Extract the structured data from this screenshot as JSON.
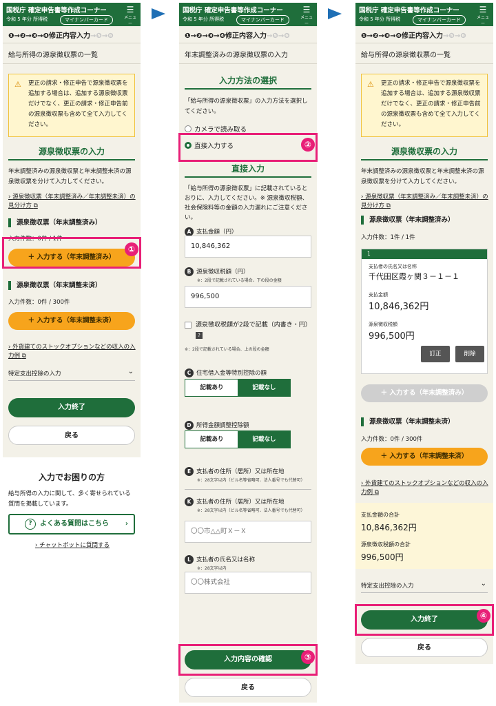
{
  "header": {
    "title": "国税庁 確定申告書等作成コーナー",
    "year": "令和 5 年分 所得税",
    "mynumber_btn": "マイナンバーカード",
    "menu_label": "メニュー"
  },
  "steps": {
    "done": "❶→❷→❸→",
    "current": "❹",
    "current_label": "修正内容入力",
    "rest": "→❺→❻"
  },
  "panel1": {
    "title": "給与所得の源泉徴収票の一覧",
    "warning": "更正の請求・修正申告で源泉徴収票を追加する場合は、追加する源泉徴収票だけでなく、更正の請求・修正申告前の源泉徴収票も含めて全て入力してください。",
    "section_title": "源泉徴収票の入力",
    "intro": "年末調整済みの源泉徴収票と年末調整未済の源泉徴収票を分けて入力してください。",
    "link1": "源泉徴収票（年末調整済み／年末調整未済）の見分け方",
    "sub1": "源泉徴収票（年末調整済み）",
    "count1": "入力件数：0件 / 1件",
    "add1": "＋ 入力する（年末調整済み）",
    "sub2": "源泉徴収票（年末調整未済）",
    "count2": "入力件数：0件 / 300件",
    "add2": "＋ 入力する（年末調整未済）",
    "link2": "外貨建てのストックオプションなどの収入の入力例",
    "accordion": "特定支出控除の入力",
    "finish": "入力終了",
    "back": "戻る",
    "help_title": "入力でお困りの方",
    "help_text": "給与所得の入力に関して、多く寄せられている質問を掲載しています。",
    "faq_btn": "よくある質問はこちら",
    "chatbot": "チャットボットに質問する"
  },
  "panel2": {
    "title": "年末調整済みの源泉徴収票の入力",
    "method_title": "入力方法の選択",
    "method_desc": "「給与所得の源泉徴収票」の入力方法を選択してください。",
    "opt_camera": "カメラで読み取る",
    "opt_direct": "直接入力する",
    "direct_title": "直接入力",
    "direct_desc": "「給与所得の源泉徴収票」に記載されているとおりに、入力してください。※ 源泉徴収税額、社会保険料等の金額の入力漏れにご注意ください。",
    "fieldA": "支払金額（円）",
    "valueA": "10,846,362",
    "fieldB": "源泉徴収税額（円）",
    "noteB": "※：2段で記載されている場合、下の段の金額",
    "valueB": "996,500",
    "chk_label": "源泉徴収税額が2段で記載（内書き・円）",
    "chk_note": "※：2段で記載されている場合、上の段の金額",
    "fieldC": "住宅借入金等特別控除の額",
    "fieldD": "所得金額調整控除額",
    "seg_yes": "記載あり",
    "seg_no": "記載なし",
    "fieldE": "支払者の住所（居所）又は所在地",
    "noteE": "※：28文字以内（ビル名等省略可、法人番号でも代替可）",
    "fieldK": "支払者の住所（居所）又は所在地",
    "noteK": "※：28文字以内（ビル名等省略可、法人番号でも代替可）",
    "valueK": "〇〇市△△町Ｘ－Ｘ",
    "fieldL": "支払者の氏名又は名称",
    "noteL": "※：28文字以内",
    "valueL": "〇〇株式会社",
    "confirm": "入力内容の確認",
    "back": "戻る"
  },
  "panel3": {
    "title": "給与所得の源泉徴収票の一覧",
    "warning": "更正の請求・修正申告で源泉徴収票を追加する場合は、追加する源泉徴収票だけでなく、更正の請求・修正申告前の源泉徴収票も含めて全て入力してください。",
    "section_title": "源泉徴収票の入力",
    "intro": "年末調整済みの源泉徴収票と年末調整未済の源泉徴収票を分けて入力してください。",
    "link1": "源泉徴収票（年末調整済み／年末調整未済）の見分け方",
    "sub1": "源泉徴収票（年末調整済み）",
    "count1": "入力件数：1件 / 1件",
    "card_index": "1",
    "card_payer_label": "支払者の氏名又は名称",
    "card_payer": "千代田区霞ヶ関３－１－１",
    "card_amount_label": "支払金額",
    "card_amount": "10,846,362円",
    "card_tax_label": "源泉徴収税額",
    "card_tax": "996,500円",
    "edit": "訂正",
    "delete": "削除",
    "add1": "＋ 入力する（年末調整済み）",
    "sub2": "源泉徴収票（年末調整未済）",
    "count2": "入力件数：0件 / 300件",
    "add2": "＋ 入力する（年末調整未済）",
    "link2": "外貨建てのストックオプションなどの収入の入力例",
    "sum_amount_label": "支払金額の合計",
    "sum_amount": "10,846,362円",
    "sum_tax_label": "源泉徴収税額の合計",
    "sum_tax": "996,500円",
    "accordion": "特定支出控除の入力",
    "finish": "入力終了",
    "back": "戻る"
  },
  "markers": {
    "m1": "①",
    "m2": "②",
    "m3": "③",
    "m4": "④"
  },
  "colors": {
    "brand_green": "#1f6e3b",
    "accent_orange": "#f7a41c",
    "highlight_pink": "#e81f77",
    "arrow_blue": "#1f6fb5"
  }
}
